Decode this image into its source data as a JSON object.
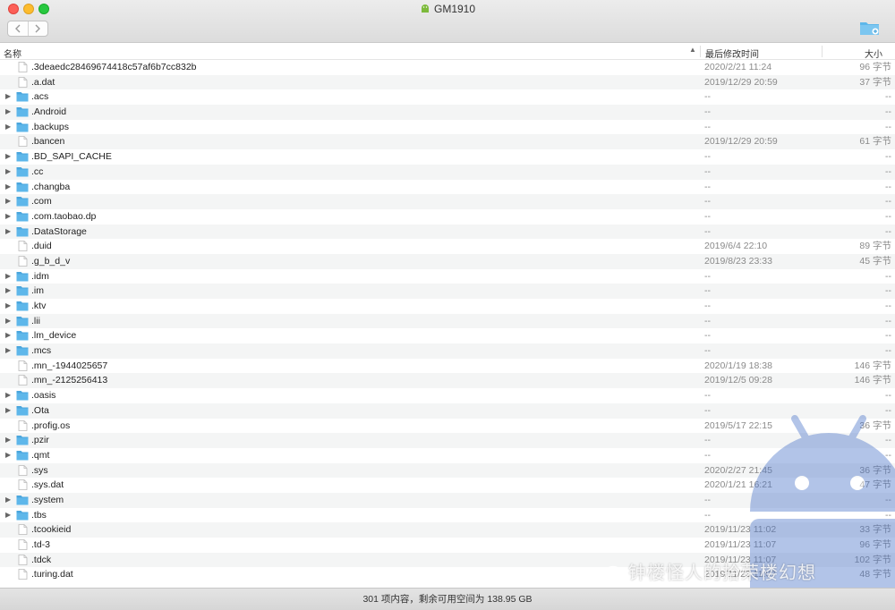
{
  "window": {
    "title": "GM1910",
    "app_icon": "android-icon",
    "nav_back_icon": "chevron-left-icon",
    "nav_forward_icon": "chevron-right-icon",
    "new_folder_icon": "new-folder-icon"
  },
  "columns": {
    "name": "名称",
    "modified": "最后修改时间",
    "size": "大小",
    "sort_indicator": "▲"
  },
  "files": [
    {
      "name": ".3deaedc28469674418c57af6b7cc832b",
      "type": "file",
      "date": "2020/2/21 11:24",
      "size": "96 字节"
    },
    {
      "name": ".a.dat",
      "type": "file",
      "date": "2019/12/29 20:59",
      "size": "37 字节"
    },
    {
      "name": ".acs",
      "type": "folder",
      "date": "--",
      "size": "--"
    },
    {
      "name": ".Android",
      "type": "folder",
      "date": "--",
      "size": "--"
    },
    {
      "name": ".backups",
      "type": "folder",
      "date": "--",
      "size": "--"
    },
    {
      "name": ".bancen",
      "type": "file",
      "date": "2019/12/29 20:59",
      "size": "61 字节"
    },
    {
      "name": ".BD_SAPI_CACHE",
      "type": "folder",
      "date": "--",
      "size": "--"
    },
    {
      "name": ".cc",
      "type": "folder",
      "date": "--",
      "size": "--"
    },
    {
      "name": ".changba",
      "type": "folder",
      "date": "--",
      "size": "--"
    },
    {
      "name": ".com",
      "type": "folder",
      "date": "--",
      "size": "--"
    },
    {
      "name": ".com.taobao.dp",
      "type": "folder",
      "date": "--",
      "size": "--"
    },
    {
      "name": ".DataStorage",
      "type": "folder",
      "date": "--",
      "size": "--"
    },
    {
      "name": ".duid",
      "type": "file",
      "date": "2019/6/4 22:10",
      "size": "89 字节"
    },
    {
      "name": ".g_b_d_v",
      "type": "file",
      "date": "2019/8/23 23:33",
      "size": "45 字节"
    },
    {
      "name": ".idm",
      "type": "folder",
      "date": "--",
      "size": "--"
    },
    {
      "name": ".im",
      "type": "folder",
      "date": "--",
      "size": "--"
    },
    {
      "name": ".ktv",
      "type": "folder",
      "date": "--",
      "size": "--"
    },
    {
      "name": ".lii",
      "type": "folder",
      "date": "--",
      "size": "--"
    },
    {
      "name": ".lm_device",
      "type": "folder",
      "date": "--",
      "size": "--"
    },
    {
      "name": ".mcs",
      "type": "folder",
      "date": "--",
      "size": "--"
    },
    {
      "name": ".mn_-1944025657",
      "type": "file",
      "date": "2020/1/19 18:38",
      "size": "146 字节"
    },
    {
      "name": ".mn_-2125256413",
      "type": "file",
      "date": "2019/12/5 09:28",
      "size": "146 字节"
    },
    {
      "name": ".oasis",
      "type": "folder",
      "date": "--",
      "size": "--"
    },
    {
      "name": ".Ota",
      "type": "folder",
      "date": "--",
      "size": "--"
    },
    {
      "name": ".profig.os",
      "type": "file",
      "date": "2019/5/17 22:15",
      "size": "36 字节"
    },
    {
      "name": ".pzir",
      "type": "folder",
      "date": "--",
      "size": "--"
    },
    {
      "name": ".qmt",
      "type": "folder",
      "date": "--",
      "size": "--"
    },
    {
      "name": ".sys",
      "type": "file",
      "date": "2020/2/27 21:45",
      "size": "36 字节"
    },
    {
      "name": ".sys.dat",
      "type": "file",
      "date": "2020/1/21 16:21",
      "size": "47 字节"
    },
    {
      "name": ".system",
      "type": "folder",
      "date": "--",
      "size": "--"
    },
    {
      "name": ".tbs",
      "type": "folder",
      "date": "--",
      "size": "--"
    },
    {
      "name": ".tcookieid",
      "type": "file",
      "date": "2019/11/23 11:02",
      "size": "33 字节"
    },
    {
      "name": ".td-3",
      "type": "file",
      "date": "2019/11/23 11:07",
      "size": "96 字节"
    },
    {
      "name": ".tdck",
      "type": "file",
      "date": "2019/11/23 11:07",
      "size": "102 字节"
    },
    {
      "name": ".turing.dat",
      "type": "file",
      "date": "2019/11/23 11:07",
      "size": "48 字节"
    }
  ],
  "status": {
    "text": "301 项内容，剩余可用空间为 138.95 GB"
  },
  "watermark": {
    "text": "钟楼怪人的拾荣楼幻想",
    "icon": "wechat-icon"
  },
  "colors": {
    "folder": "#5eb7ea",
    "folder_tab": "#4aa6dd",
    "file_border": "#b9b9b9",
    "android_green": "#7dba3c",
    "watermark_blue": "#4a74c9"
  }
}
